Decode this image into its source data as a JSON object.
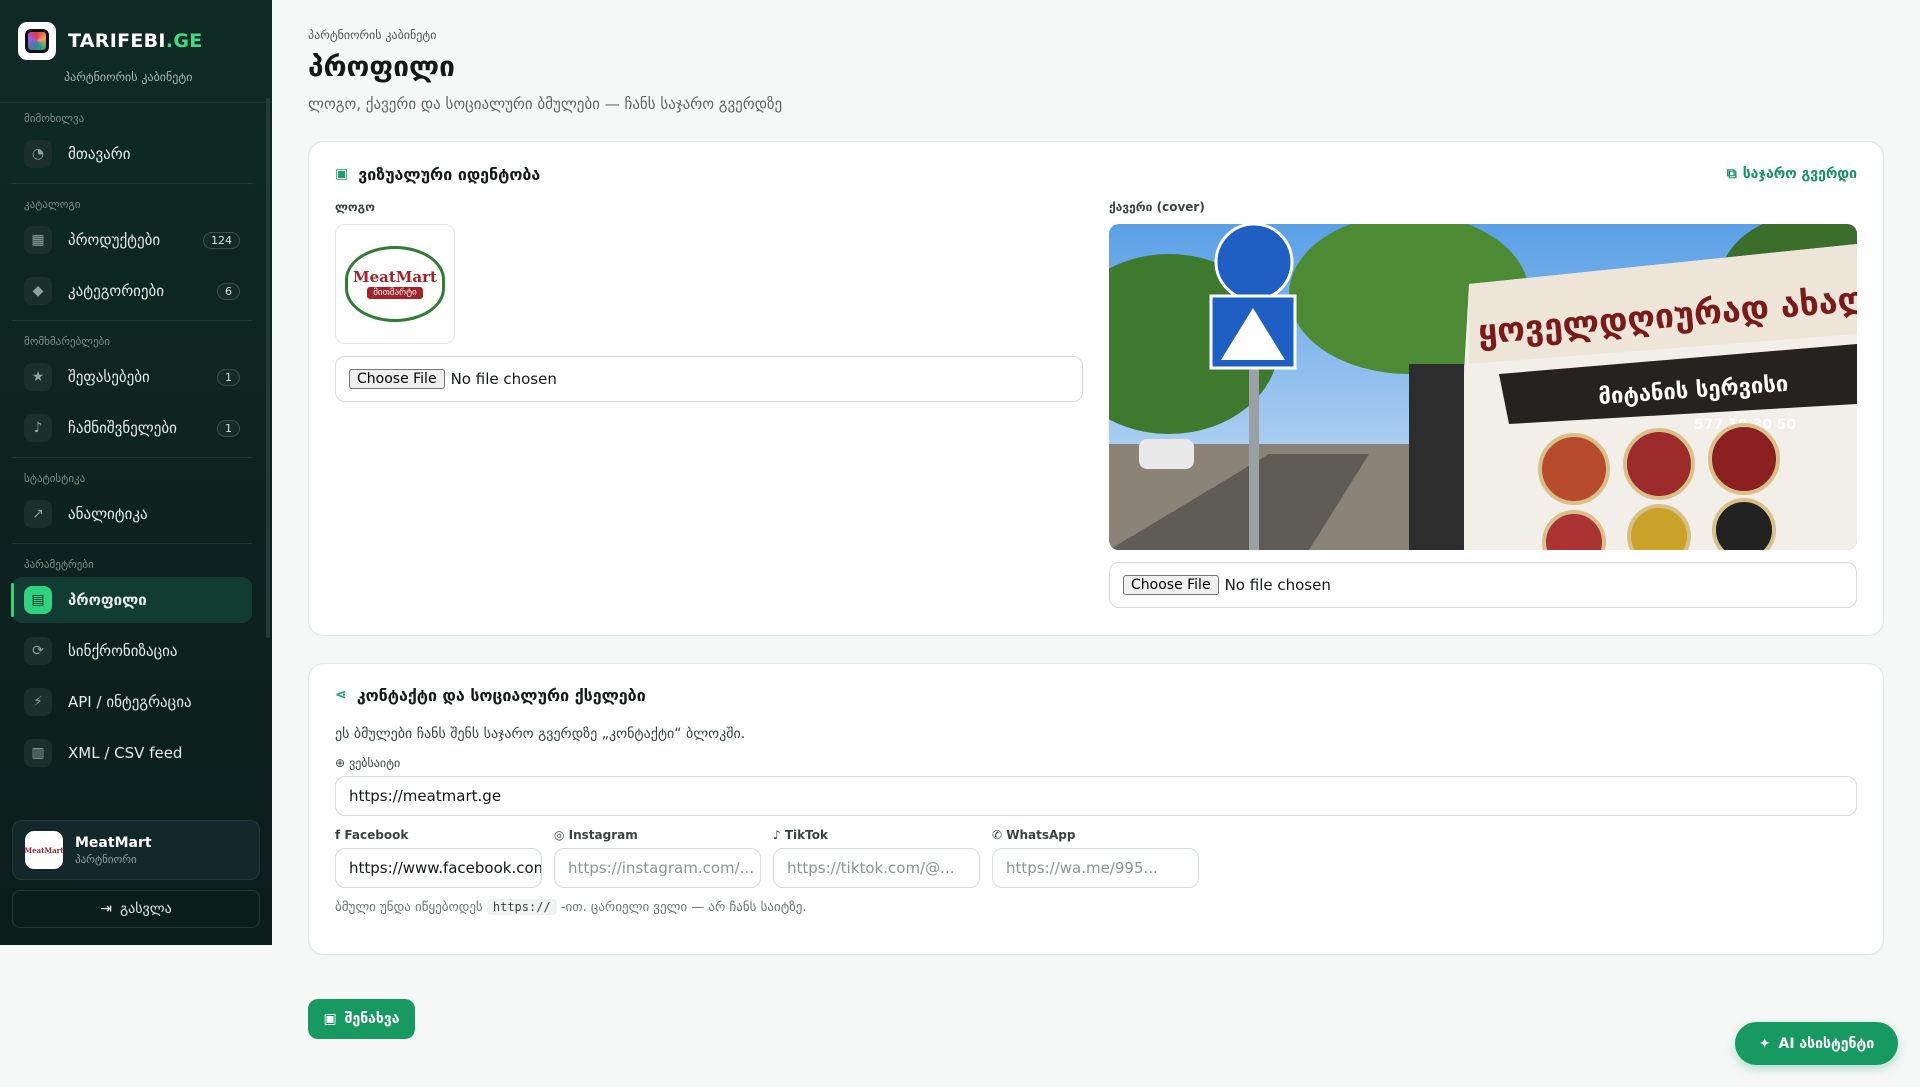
{
  "sidebar": {
    "brand": {
      "name_main": "TARIFEBI",
      "name_accent": ".GE",
      "subtitle": "პარტნიორის კაბინეტი"
    },
    "groups": [
      {
        "title": "მიმოხილვა",
        "items": [
          {
            "label": "მთავარი",
            "icon": "pie-chart-icon"
          }
        ]
      },
      {
        "title": "კატალოგი",
        "items": [
          {
            "label": "პროდუქტები",
            "icon": "box-icon",
            "badge": "124"
          },
          {
            "label": "კატეგორიები",
            "icon": "tag-icon",
            "badge": "6"
          }
        ]
      },
      {
        "title": "მომხმარებლები",
        "items": [
          {
            "label": "შეფასებები",
            "icon": "star-icon",
            "badge": "1"
          },
          {
            "label": "ჩამნიშვნელები",
            "icon": "bell-icon",
            "badge": "1"
          }
        ]
      },
      {
        "title": "სტატისტიკა",
        "items": [
          {
            "label": "ანალიტიკა",
            "icon": "line-chart-icon"
          }
        ]
      },
      {
        "title": "პარამეტრები",
        "items": [
          {
            "label": "პროფილი",
            "icon": "store-icon",
            "active": true
          },
          {
            "label": "სინქრონიზაცია",
            "icon": "sync-icon"
          },
          {
            "label": "API / ინტეგრაცია",
            "icon": "plug-icon"
          },
          {
            "label": "XML / CSV feed",
            "icon": "file-icon"
          }
        ]
      }
    ],
    "user": {
      "name": "MeatMart",
      "role": "პარტნიორი"
    },
    "logout_label": "გასვლა"
  },
  "page": {
    "breadcrumb": "პარტნიორის კაბინეტი",
    "title": "პროფილი",
    "description": "ლოგო, ქავერი და სოციალური ბმულები — ჩანს საჯარო გვერდზე"
  },
  "visual_card": {
    "title": "ვიზუალური იდენტობა",
    "public_link": "საჯარო გვერდი",
    "logo_label": "ლოგო",
    "logo_text": "MeatMart",
    "logo_subtext": "მითმარტი",
    "cover_label": "ქავერი (cover)",
    "file_button": "Choose File",
    "file_status": "No file chosen",
    "cover_sign_top": "ყოველდღიურად ახალი",
    "cover_sign_delivery": "მიტანის სერვისი",
    "cover_sign_phone": "577 10 30 50"
  },
  "contact_card": {
    "title": "კონტაქტი და სოციალური ქსელები",
    "description": "ეს ბმულები ჩანს შენს საჯარო გვერდზე „კონტაქტი“ ბლოკში.",
    "website": {
      "label": "ვებსაიტი",
      "value": "https://meatmart.ge"
    },
    "facebook": {
      "label": "Facebook",
      "value": "https://www.facebook.com"
    },
    "instagram": {
      "label": "Instagram",
      "placeholder": "https://instagram.com/..."
    },
    "tiktok": {
      "label": "TikTok",
      "placeholder": "https://tiktok.com/@..."
    },
    "whatsapp": {
      "label": "WhatsApp",
      "placeholder": "https://wa.me/995..."
    },
    "hint_before": "ბმული უნდა იწყებოდეს",
    "hint_code": "https://",
    "hint_after": "-ით. ცარიელი ველი — არ ჩანს საიტზე."
  },
  "actions": {
    "save": "შენახვა",
    "ai": "AI ასისტენტი"
  },
  "colors": {
    "accent": "#169a62",
    "sidebar_bg": "#0f2a25"
  }
}
